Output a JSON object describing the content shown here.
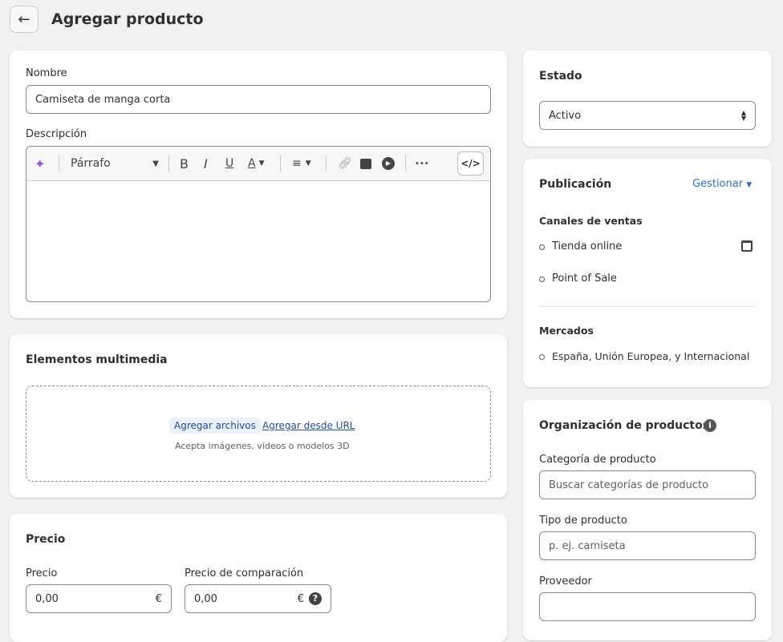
{
  "header": {
    "title": "Agregar producto",
    "back_icon": "arrow-left-icon"
  },
  "product": {
    "name_label": "Nombre",
    "name_value": "Camiseta de manga corta",
    "description_label": "Descripción",
    "toolbar": {
      "paragraph": "Párrafo",
      "bold": "B",
      "italic": "I",
      "underline": "U",
      "color": "A",
      "more": "•••",
      "code": "</>"
    }
  },
  "media": {
    "title": "Elementos multimedia",
    "add_files": "Agregar archivos",
    "add_url": "Agregar desde URL",
    "hint": "Acepta imágenes, vídeos o modelos 3D"
  },
  "price": {
    "title": "Precio",
    "price_label": "Precio",
    "price_value": "0,00",
    "currency": "€",
    "compare_label": "Precio de comparación",
    "compare_value": "0,00"
  },
  "status": {
    "title": "Estado",
    "value": "Activo"
  },
  "publication": {
    "title": "Publicación",
    "manage": "Gestionar",
    "channels_label": "Canales de ventas",
    "channels": [
      "Tienda online",
      "Point of Sale"
    ],
    "markets_label": "Mercados",
    "markets": "España, Unión Europea, y Internacional"
  },
  "organization": {
    "title": "Organización de productos",
    "category_label": "Categoría de producto",
    "category_placeholder": "Buscar categorías de producto",
    "type_label": "Tipo de producto",
    "type_placeholder": "p. ej. camiseta",
    "vendor_label": "Proveedor"
  },
  "colors": {
    "accent": "#2c6ecb",
    "background": "#f1f1f1",
    "ai": "#9b51e0"
  }
}
